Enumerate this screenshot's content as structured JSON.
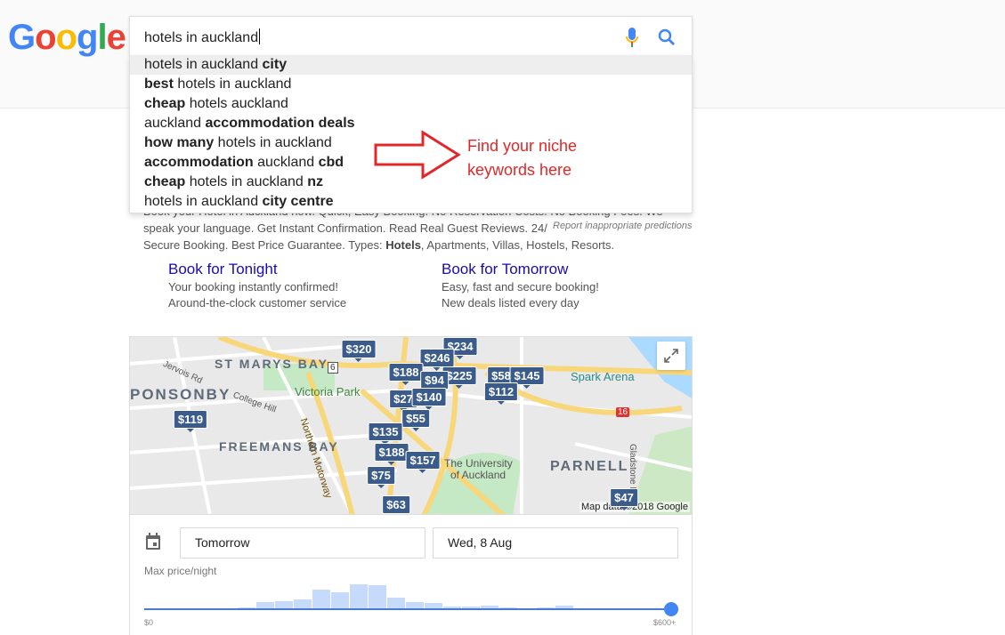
{
  "logo": "Google",
  "search": {
    "query": "hotels in auckland",
    "mic_icon": "microphone-icon",
    "search_icon": "magnifier-icon"
  },
  "suggestions": [
    [
      {
        "t": "hotels in auckland ",
        "b": false
      },
      {
        "t": "city",
        "b": true
      }
    ],
    [
      {
        "t": "best",
        "b": true
      },
      {
        "t": " hotels in auckland",
        "b": false
      }
    ],
    [
      {
        "t": "cheap",
        "b": true
      },
      {
        "t": " hotels auckland",
        "b": false
      }
    ],
    [
      {
        "t": "auckland ",
        "b": false
      },
      {
        "t": "accommodation deals",
        "b": true
      }
    ],
    [
      {
        "t": "how many",
        "b": true
      },
      {
        "t": " hotels in auckland",
        "b": false
      }
    ],
    [
      {
        "t": "accommodation",
        "b": true
      },
      {
        "t": " auckland ",
        "b": false
      },
      {
        "t": "cbd",
        "b": true
      }
    ],
    [
      {
        "t": "cheap",
        "b": true
      },
      {
        "t": " hotels in auckland ",
        "b": false
      },
      {
        "t": "nz",
        "b": true
      }
    ],
    [
      {
        "t": "hotels in auckland ",
        "b": false
      },
      {
        "t": "city centre",
        "b": true
      }
    ]
  ],
  "annotation": {
    "line1": "Find your niche",
    "line2": "keywords here",
    "color": "#e0282a"
  },
  "ad": {
    "line1": "Book your Hotel in Auckland now. Quick, Easy Booking. No Reservation Costs. No Booking Fees. We",
    "line2": "speak your language. Get Instant Confirmation. Read Real Guest Reviews. 24/",
    "line3a": "Secure Booking. Best Price Guarantee. Types: ",
    "line3b": "Hotels",
    "line3c": ", Apartments, Villas, Hostels, Resorts.",
    "report": "Report inappropriate predictions"
  },
  "sitelinks": [
    {
      "title": "Book for Tonight",
      "l1": "Your booking instantly confirmed!",
      "l2": "Around-the-clock customer service"
    },
    {
      "title": "Book for Tomorrow",
      "l1": "Easy, fast and secure booking!",
      "l2": "New deals listed every day"
    }
  ],
  "map": {
    "labels": [
      "ST MARYS BAY",
      "PONSONBY",
      "FREEMANS BAY",
      "PARNELL",
      "Victoria Park",
      "Spark Arena",
      "The University",
      "of Auckland",
      "Northern Motorway",
      "Jervois Rd",
      "College Hill",
      "Gladstone Rd",
      "6",
      "16"
    ],
    "prices": [
      "$320",
      "$234",
      "$246",
      "$188",
      "$225",
      "$94",
      "$58",
      "$145",
      "$27",
      "$140",
      "$112",
      "$55",
      "$119",
      "$135",
      "$188",
      "$157",
      "$75",
      "$63",
      "$47"
    ],
    "attribution": "Map data ©2018 Google"
  },
  "dates": {
    "checkin": "Tomorrow",
    "checkout": "Wed, 8 Aug"
  },
  "price_filter": {
    "label": "Max price/night",
    "min": "$0",
    "max": "$600+",
    "selected_fraction": 1.0,
    "histogram": [
      2,
      8,
      9,
      11,
      22,
      19,
      28,
      27,
      13,
      8,
      7,
      3,
      3,
      4,
      2,
      1,
      2,
      4
    ]
  }
}
